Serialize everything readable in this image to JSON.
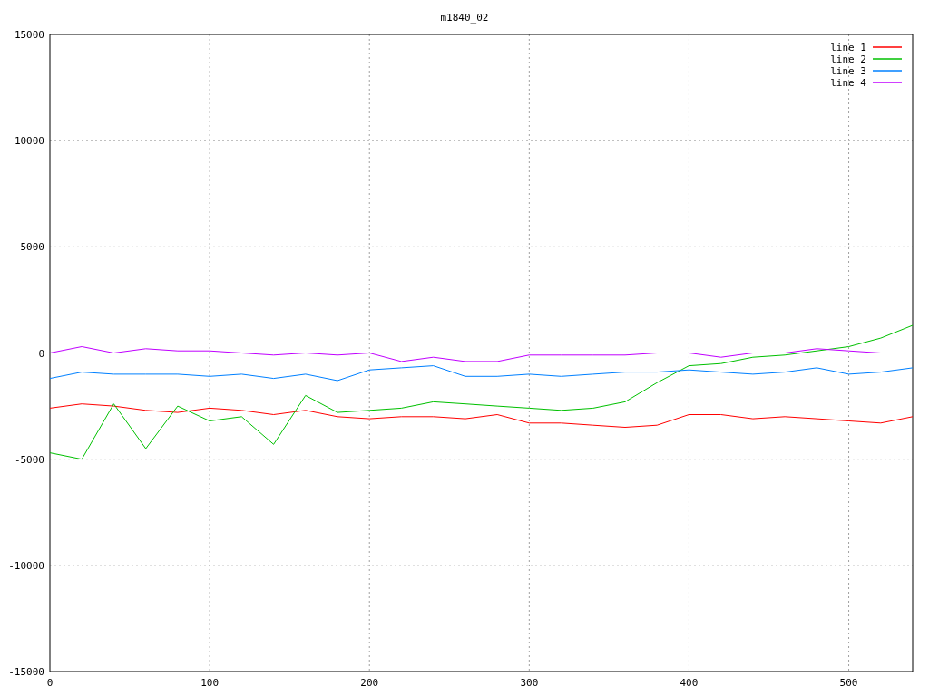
{
  "plot": {
    "chart_data": {
      "type": "line",
      "title": "m1840_02",
      "x": [
        0,
        20,
        40,
        60,
        80,
        100,
        120,
        140,
        160,
        180,
        200,
        220,
        240,
        260,
        280,
        300,
        320,
        340,
        360,
        380,
        400,
        420,
        440,
        460,
        480,
        500,
        520,
        540
      ],
      "series": [
        {
          "name": "line 1",
          "color": "#ff0000",
          "values": [
            -2600,
            -2400,
            -2500,
            -2700,
            -2800,
            -2600,
            -2700,
            -2900,
            -2700,
            -3000,
            -3100,
            -3000,
            -3000,
            -3100,
            -2900,
            -3300,
            -3300,
            -3400,
            -3500,
            -3400,
            -2900,
            -2900,
            -3100,
            -3000,
            -3100,
            -3200,
            -3300,
            -3000
          ]
        },
        {
          "name": "line 2",
          "color": "#00c000",
          "values": [
            -4700,
            -5000,
            -2400,
            -4500,
            -2500,
            -3200,
            -3000,
            -4300,
            -2000,
            -2800,
            -2700,
            -2600,
            -2300,
            -2400,
            -2500,
            -2600,
            -2700,
            -2600,
            -2300,
            -1400,
            -600,
            -500,
            -200,
            -100,
            100,
            300,
            700,
            1300
          ]
        },
        {
          "name": "line 3",
          "color": "#0080ff",
          "values": [
            -1200,
            -900,
            -1000,
            -1000,
            -1000,
            -1100,
            -1000,
            -1200,
            -1000,
            -1300,
            -800,
            -700,
            -600,
            -1100,
            -1100,
            -1000,
            -1100,
            -1000,
            -900,
            -900,
            -800,
            -900,
            -1000,
            -900,
            -700,
            -1000,
            -900,
            -700
          ]
        },
        {
          "name": "line 4",
          "color": "#c000ff",
          "values": [
            0,
            300,
            0,
            200,
            100,
            100,
            0,
            -100,
            0,
            -100,
            0,
            -400,
            -200,
            -400,
            -400,
            -100,
            -100,
            -100,
            -100,
            0,
            0,
            -200,
            0,
            0,
            200,
            100,
            0,
            0
          ]
        }
      ],
      "grid": true,
      "legend": true,
      "xlim": [
        0,
        540
      ],
      "ylim": [
        -15000,
        15000
      ],
      "xticks": [
        0,
        100,
        200,
        300,
        400,
        500
      ],
      "yticks": [
        {
          "value": -15000,
          "label": "-15000"
        },
        {
          "value": -10000,
          "label": "-10000"
        },
        {
          "value": -5000,
          "label": "-5000"
        },
        {
          "value": 0,
          "label": "0"
        },
        {
          "value": 5000,
          "label": "5000"
        },
        {
          "value": 10000,
          "label": "10000"
        },
        {
          "value": 15000,
          "label": "15000"
        }
      ]
    }
  }
}
